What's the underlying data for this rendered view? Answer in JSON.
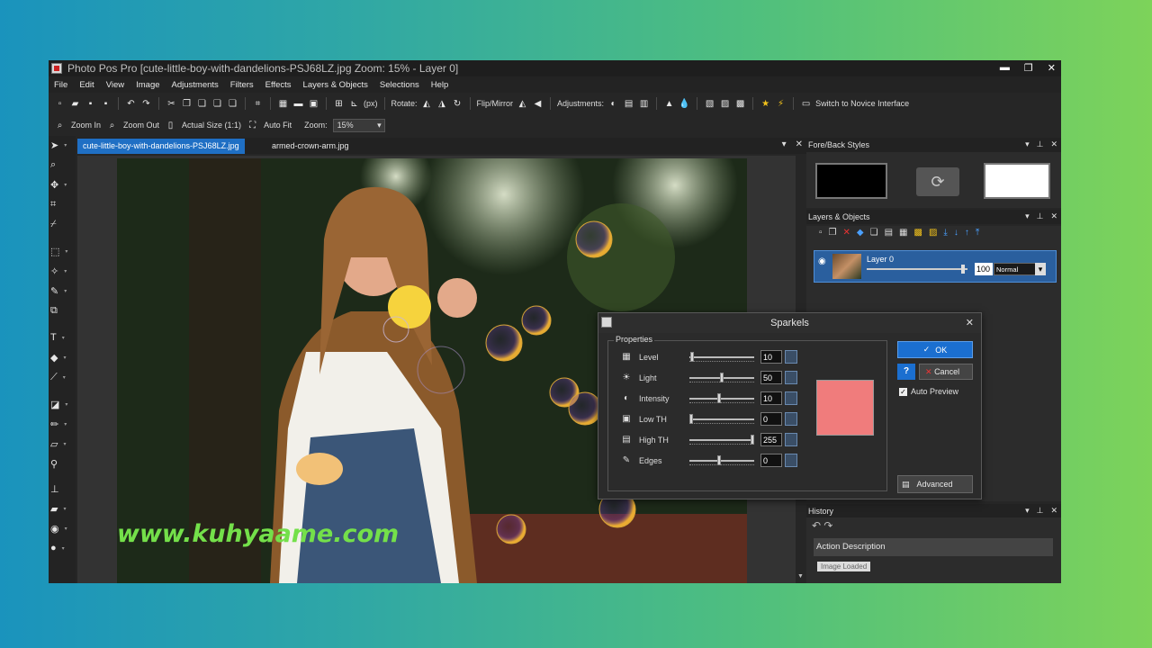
{
  "window": {
    "title": "Photo Pos Pro [cute-little-boy-with-dandelions-PSJ68LZ.jpg Zoom: 15% - Layer 0]",
    "controls": [
      "▬",
      "❐",
      "✕"
    ]
  },
  "menu": [
    "File",
    "Edit",
    "View",
    "Image",
    "Adjustments",
    "Filters",
    "Effects",
    "Layers & Objects",
    "Selections",
    "Help"
  ],
  "toolbar": {
    "units_label": "(px)",
    "rotate_label": "Rotate:",
    "flip_label": "Flip/Mirror",
    "adjustments_label": "Adjustments:",
    "novice_label": "Switch to Novice Interface",
    "zoom_in_label": "Zoom In",
    "zoom_out_label": "Zoom Out",
    "actual_size_label": "Actual Size (1:1)",
    "auto_fit_label": "Auto Fit",
    "zoom_label": "Zoom:",
    "zoom_value": "15%"
  },
  "tabs": [
    {
      "label": "cute-little-boy-with-dandelions-PSJ68LZ.jpg",
      "active": true
    },
    {
      "label": "armed-crown-arm.jpg",
      "active": false
    }
  ],
  "panels": {
    "fore_back_title": "Fore/Back Styles",
    "fore_color": "#000000",
    "back_color": "#ffffff",
    "layers_title": "Layers & Objects",
    "layer": {
      "name": "Layer 0",
      "opacity": "100",
      "mode": "Normal",
      "opacity_fraction": 0.97
    },
    "history_title": "History",
    "history_column": "Action Description",
    "history_item": "Image Loaded"
  },
  "dialog": {
    "title": "Sparkels",
    "group_label": "Properties",
    "params": [
      {
        "label": "Level",
        "value": "10",
        "fraction": 0.02
      },
      {
        "label": "Light",
        "value": "50",
        "fraction": 0.5
      },
      {
        "label": "Intensity",
        "value": "10",
        "fraction": 0.45
      },
      {
        "label": "Low TH",
        "value": "0",
        "fraction": 0.0
      },
      {
        "label": "High TH",
        "value": "255",
        "fraction": 1.0
      },
      {
        "label": "Edges",
        "value": "0",
        "fraction": 0.45
      }
    ],
    "sparkle_color": "#f07c7c",
    "ok_label": "OK",
    "cancel_label": "Cancel",
    "help_label": "?",
    "auto_preview_label": "Auto Preview",
    "auto_preview_checked": true,
    "advanced_label": "Advanced"
  },
  "watermark": "www.kuhyaame.com"
}
